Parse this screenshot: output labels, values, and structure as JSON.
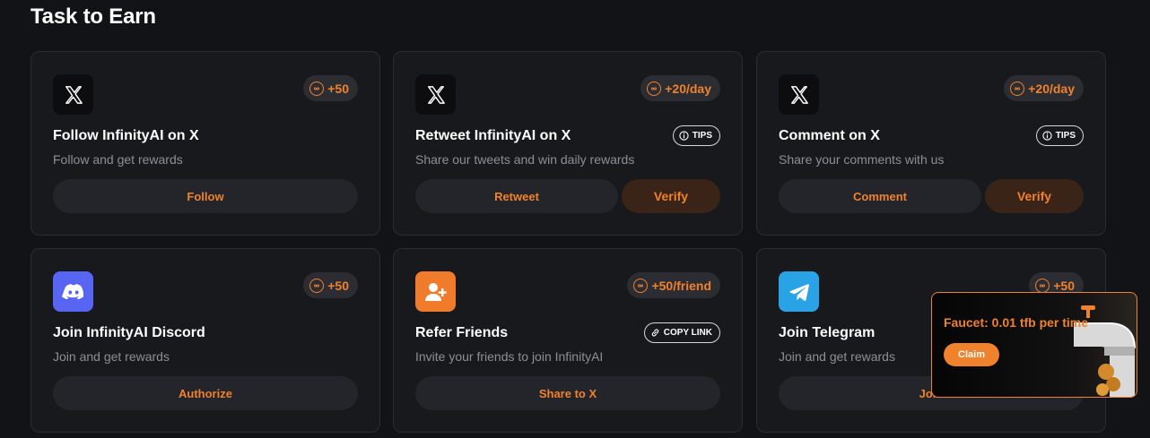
{
  "page": {
    "title": "Task to Earn"
  },
  "colors": {
    "accent": "#f0822d",
    "card_bg": "#18191d",
    "page_bg": "#121316"
  },
  "tasks": [
    {
      "icon": "x-logo-icon",
      "reward": "+50",
      "title": "Follow InfinityAI on X",
      "description": "Follow and get rewards",
      "button": "Follow"
    },
    {
      "icon": "x-logo-icon",
      "reward": "+20/day",
      "title": "Retweet InfinityAI on X",
      "description": "Share our tweets and win daily rewards",
      "tag": "TIPS",
      "button": "Retweet",
      "verify": "Verify"
    },
    {
      "icon": "x-logo-icon",
      "reward": "+20/day",
      "title": "Comment on X",
      "description": "Share your comments with us",
      "tag": "TIPS",
      "button": "Comment",
      "verify": "Verify"
    },
    {
      "icon": "discord-icon",
      "reward": "+50",
      "title": "Join InfinityAI Discord",
      "description": "Join and get rewards",
      "button": "Authorize"
    },
    {
      "icon": "add-user-icon",
      "reward": "+50/friend",
      "title": "Refer Friends",
      "description": "Invite your friends to join InfinityAI",
      "tag": "COPY LINK",
      "button": "Share to X"
    },
    {
      "icon": "telegram-icon",
      "reward": "+50",
      "title": "Join Telegram",
      "description": "Join and get rewards",
      "button": "Join"
    }
  ],
  "faucet": {
    "text": "Faucet: 0.01 tfb per time",
    "claim": "Claim"
  }
}
